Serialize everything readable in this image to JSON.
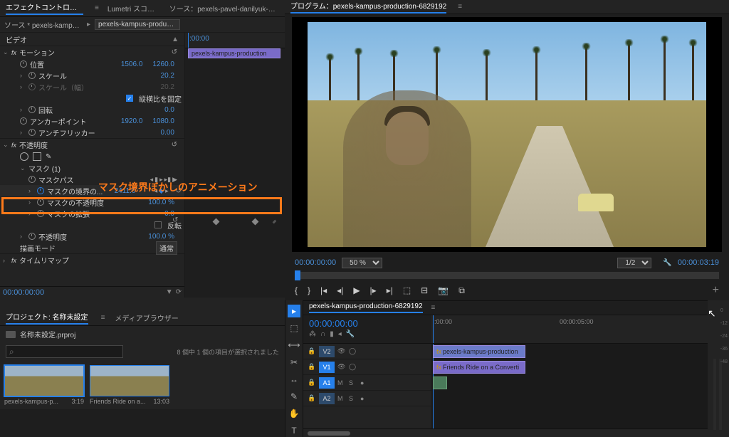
{
  "tabs": {
    "effect_controls": "エフェクトコントロール",
    "lumetri": "Lumetri スコープ",
    "source": "ソース：pexels-pavel-danilyuk-667",
    "program": "プログラム：",
    "program_name": "pexels-kampus-production-6829192"
  },
  "src_row": {
    "source_star": "ソース * pexels-kampus-pr...",
    "selected_clip": "pexels-kampus-producti..."
  },
  "mini_time": ":00:00",
  "clip_label": "pexels-kampus-production",
  "video_header": "ビデオ",
  "fx": {
    "motion": "モーション",
    "position": "位置",
    "position_x": "1506.0",
    "position_y": "1260.0",
    "scale": "スケール",
    "scale_val": "20.2",
    "scale_w": "スケール（幅）",
    "scale_w_val": "20.2",
    "uniform": "縦横比を固定",
    "rotation": "回転",
    "rotation_val": "0.0",
    "anchor": "アンカーポイント",
    "anchor_x": "1920.0",
    "anchor_y": "1080.0",
    "antiflicker": "アンチフリッカー",
    "antiflicker_val": "0.00",
    "opacity": "不透明度",
    "opacity_val": "100.0 %",
    "mask1": "マスク (1)",
    "mask_path": "マスクパス",
    "mask_feather": "マスクの境界の...",
    "mask_feather_val": "2411.0",
    "mask_opacity": "マスクの不透明度",
    "mask_opacity_val": "100.0 %",
    "mask_expansion": "マスクの拡張",
    "mask_expansion_val": "0.0",
    "invert": "反転",
    "blend_mode": "描画モード",
    "blend_mode_val": "通常",
    "time_remap": "タイムリマップ"
  },
  "annotation": "マスク境界ぼかしのアニメーション",
  "time_left_corner": "00:00:00:00",
  "program_monitor": {
    "time_left": "00:00:00:00",
    "zoom": "50 %",
    "res": "1/2",
    "time_right": "00:00:03:19"
  },
  "project": {
    "tab_project": "プロジェクト: 名称未設定",
    "tab_media": "メディアブラウザー",
    "bin": "名称未設定.prproj",
    "search_ph": "⌕",
    "items_info": "8 個中 1 個の項目が選択されました",
    "thumb1_name": "pexels-kampus-p...",
    "thumb1_dur": "3:19",
    "thumb2_name": "Friends Ride on a...",
    "thumb2_dur": "13:03"
  },
  "timeline": {
    "seq_name": "pexels-kampus-production-6829192",
    "time": "00:00:00:00",
    "tick0": ":00:00",
    "tick1": "00:00:05:00",
    "v2": "V2",
    "v1": "V1",
    "a1": "A1",
    "a2": "A2",
    "clip_v2": "pexels-kampus-production",
    "clip_v1": "Friends Ride on a Converti",
    "fx_marker": "fx"
  },
  "meter": {
    "m0": "0",
    "m12": "-12",
    "m24": "-24",
    "m36": "-36",
    "m48": "-48"
  }
}
